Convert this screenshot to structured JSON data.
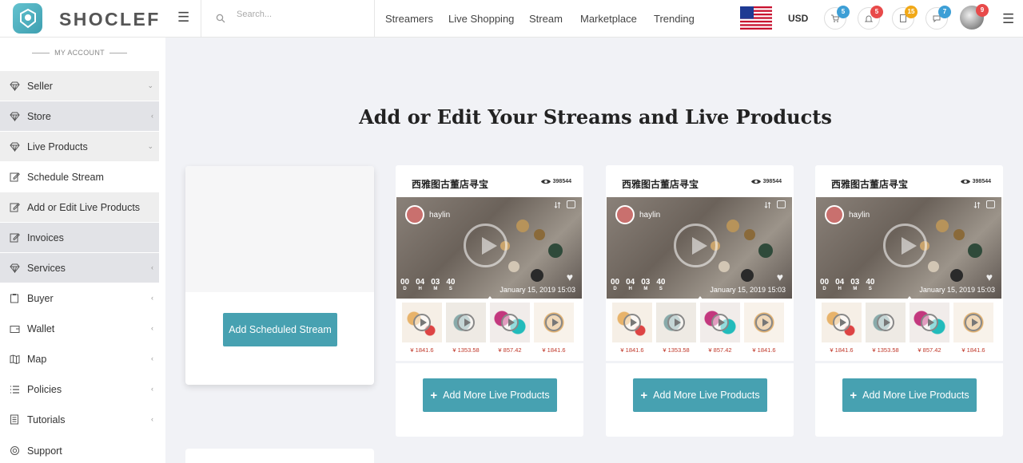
{
  "header": {
    "brand": "SHOCLEF",
    "search_placeholder": "Search...",
    "nav": [
      "Streamers",
      "Live Shopping",
      "Stream",
      "Marketplace",
      "Trending"
    ],
    "currency": "USD",
    "badges": {
      "cart": "5",
      "alerts": "5",
      "orders": "15",
      "messages": "7",
      "profile": "9"
    },
    "badge_colors": {
      "blue": "#3d9fd6",
      "red": "#e84a4a",
      "orange": "#f1a817"
    }
  },
  "sidebar": {
    "heading": "MY ACCOUNT",
    "items": [
      {
        "label": "Seller",
        "icon": "diamond-icon"
      },
      {
        "label": "Store",
        "icon": "diamond-icon"
      },
      {
        "label": "Live Products",
        "icon": "diamond-icon"
      },
      {
        "label": "Schedule Stream",
        "icon": "edit-icon"
      },
      {
        "label": "Add or Edit Live Products",
        "icon": "edit-icon"
      },
      {
        "label": "Invoices",
        "icon": "edit-icon"
      },
      {
        "label": "Services",
        "icon": "diamond-icon"
      },
      {
        "label": "Buyer",
        "icon": "clipboard-icon"
      },
      {
        "label": "Wallet",
        "icon": "wallet-icon"
      },
      {
        "label": "Map",
        "icon": "map-icon"
      },
      {
        "label": "Policies",
        "icon": "list-icon"
      },
      {
        "label": "Tutorials",
        "icon": "book-icon"
      },
      {
        "label": "Support",
        "icon": "support-icon"
      }
    ]
  },
  "main": {
    "title": "Add or Edit Your Streams and Live Products",
    "add_scheduled_label": "Add Scheduled Stream",
    "accent": "#47a1b1",
    "streams": [
      {
        "name": "西雅图古董店寻宝",
        "views": "398544",
        "host": "haylin",
        "countdown": [
          {
            "v": "00",
            "u": "D"
          },
          {
            "v": "04",
            "u": "H"
          },
          {
            "v": "03",
            "u": "M"
          },
          {
            "v": "40",
            "u": "S"
          }
        ],
        "date": "January 15, 2019 15:03",
        "prices": [
          "¥ 1841.6",
          "¥ 1353.58",
          "¥ 857.42",
          "¥ 1841.6"
        ],
        "add_more_label": "Add More Live Products"
      },
      {
        "name": "西雅图古董店寻宝",
        "views": "398544",
        "host": "haylin",
        "countdown": [
          {
            "v": "00",
            "u": "D"
          },
          {
            "v": "04",
            "u": "H"
          },
          {
            "v": "03",
            "u": "M"
          },
          {
            "v": "40",
            "u": "S"
          }
        ],
        "date": "January 15, 2019 15:03",
        "prices": [
          "¥ 1841.6",
          "¥ 1353.58",
          "¥ 857.42",
          "¥ 1841.6"
        ],
        "add_more_label": "Add More Live Products"
      },
      {
        "name": "西雅图古董店寻宝",
        "views": "398544",
        "host": "haylin",
        "countdown": [
          {
            "v": "00",
            "u": "D"
          },
          {
            "v": "04",
            "u": "H"
          },
          {
            "v": "03",
            "u": "M"
          },
          {
            "v": "40",
            "u": "S"
          }
        ],
        "date": "January 15, 2019 15:03",
        "prices": [
          "¥ 1841.6",
          "¥ 1353.58",
          "¥ 857.42",
          "¥ 1841.6"
        ],
        "add_more_label": "Add More Live Products"
      }
    ]
  }
}
